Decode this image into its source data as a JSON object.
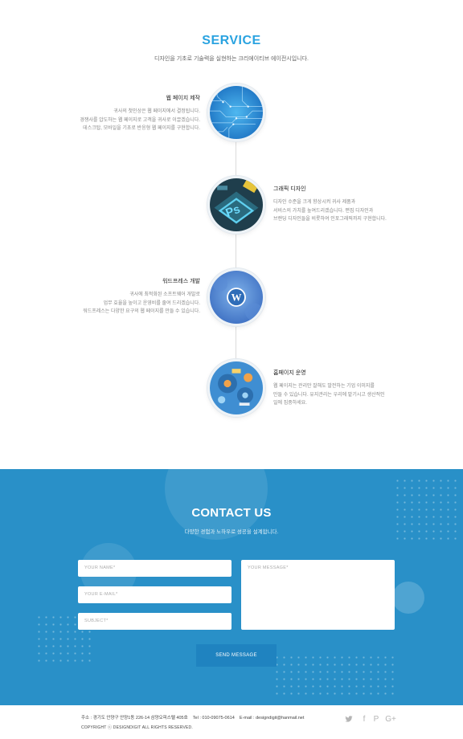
{
  "service": {
    "title": "SERVICE",
    "subtitle": "디자인을 기초로 기술력을 실현하는 크리에이티브 에이전시입니다.",
    "items": [
      {
        "heading": "웹 페이지 제작",
        "lines": [
          "귀사의 첫인상은 웹 페이지에서 결정됩니다.",
          "경쟁사를 압도하는 웹 페이지로 고객을 귀사로 이끌겠습니다.",
          "데스크탑, 모바일을 기초로 반응형 웹 페이지를 구현합니다."
        ]
      },
      {
        "heading": "그래픽 디자인",
        "lines": [
          "디자인 수준을 크게 향상시켜 귀사 제품과",
          "서비스의 가치를 높여드리겠습니다. 편집 디자인과",
          "브랜딩 디자인들을 비롯하여 인포그래픽까지 구현합니다."
        ]
      },
      {
        "heading": "워드프레스 개발",
        "lines": [
          "귀사에 최적화된 소프트웨어 개발로",
          "업무 효율을 높이고 운영비를 줄여 드리겠습니다.",
          "워드프레스는 다양한 요구의 웹 페이지를 만들 수 있습니다."
        ]
      },
      {
        "heading": "홈페이지 운영",
        "lines": [
          "웹 페이지는 관리만 잘해도 발전하는 기업 이미지를",
          "만들 수 있습니다. 유지관리는 우리에 맡기시고 생산적인",
          "일에 집중하세요."
        ]
      }
    ]
  },
  "contact": {
    "title": "CONTACT US",
    "subtitle": "다양한 경험과 노하우로 성공을 설계합니다.",
    "name_placeholder": "YOUR NAME*",
    "email_placeholder": "YOUR E-MAIL*",
    "subject_placeholder": "SUBJECT*",
    "message_placeholder": "YOUR MESSAGE*",
    "send_label": "SEND MESSAGE",
    "colors": {
      "background": "#2990c8",
      "button": "#1f83c0"
    }
  },
  "footer": {
    "address": "주소 : 경기도 안양구 안양1동 226-14 삼양오피스텔 405호",
    "tel": "Tel : 010-09075-0614",
    "email": "E-mail : designdigit@hanmail.net",
    "copyright": "COPYRIGHT ⓒ DESIGNDIGIT ALL RIGHTS RESERVED.",
    "social_icons": [
      {
        "name": "twitter-icon",
        "glyph": "🐦"
      },
      {
        "name": "facebook-icon",
        "glyph": "f"
      },
      {
        "name": "pinterest-icon",
        "glyph": "P"
      },
      {
        "name": "google-plus-icon",
        "glyph": "G+"
      }
    ]
  }
}
